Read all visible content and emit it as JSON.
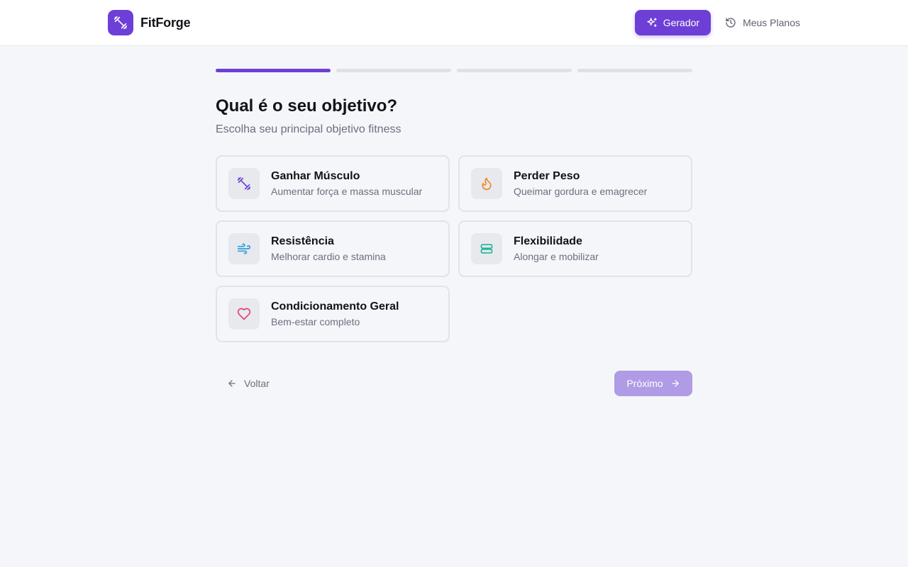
{
  "app": {
    "name": "FitForge",
    "accent": "#6d3fd6"
  },
  "nav": {
    "generator_label": "Gerador",
    "plans_label": "Meus Planos"
  },
  "progress": {
    "steps_total": 4,
    "current_step": 1
  },
  "step": {
    "title": "Qual é o seu objetivo?",
    "subtitle": "Escolha seu principal objetivo fitness"
  },
  "goals": [
    {
      "title": "Ganhar Músculo",
      "desc": "Aumentar força e massa muscular",
      "icon": "dumbbell-icon",
      "color": "#6d3fd6"
    },
    {
      "title": "Perder Peso",
      "desc": "Queimar gordura e emagrecer",
      "icon": "flame-icon",
      "color": "#f08a24"
    },
    {
      "title": "Resistência",
      "desc": "Melhorar cardio e stamina",
      "icon": "wind-icon",
      "color": "#2a9fd8"
    },
    {
      "title": "Flexibilidade",
      "desc": "Alongar e mobilizar",
      "icon": "stretch-icon",
      "color": "#1fb59a"
    },
    {
      "title": "Condicionamento Geral",
      "desc": "Bem-estar completo",
      "icon": "heart-icon",
      "color": "#e0407a"
    }
  ],
  "footer": {
    "back_label": "Voltar",
    "next_label": "Próximo"
  }
}
